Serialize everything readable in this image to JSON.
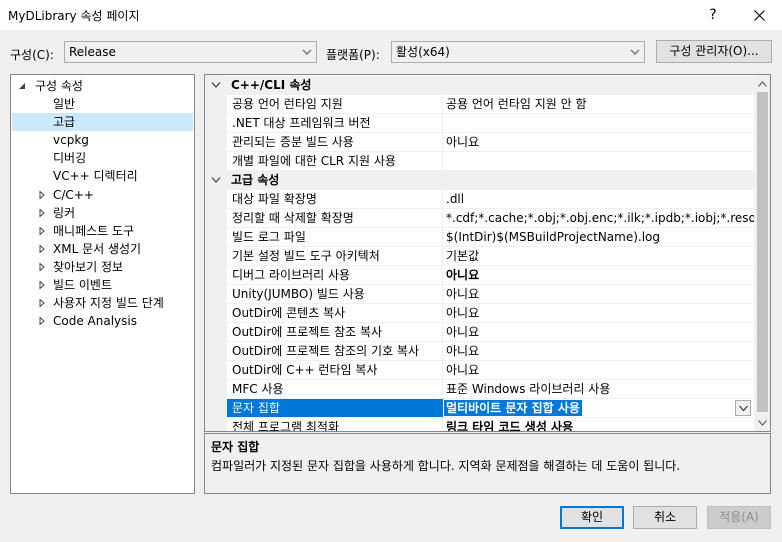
{
  "window": {
    "title": "MyDLibrary 속성 페이지",
    "help_label": "?",
    "close_icon": "close-icon"
  },
  "toolbar": {
    "config_label": "구성(C):",
    "config_value": "Release",
    "platform_label": "플랫폼(P):",
    "platform_value": "활성(x64)",
    "config_manager_label": "구성 관리자(O)..."
  },
  "tree": {
    "items": [
      {
        "label": "구성 속성",
        "expanded": true
      },
      {
        "label": "일반"
      },
      {
        "label": "고급",
        "selected": true
      },
      {
        "label": "vcpkg"
      },
      {
        "label": "디버깅"
      },
      {
        "label": "VC++ 디렉터리"
      },
      {
        "label": "C/C++",
        "collapsed": true
      },
      {
        "label": "링커",
        "collapsed": true
      },
      {
        "label": "매니페스트 도구",
        "collapsed": true
      },
      {
        "label": "XML 문서 생성기",
        "collapsed": true
      },
      {
        "label": "찾아보기 정보",
        "collapsed": true
      },
      {
        "label": "빌드 이벤트",
        "collapsed": true
      },
      {
        "label": "사용자 지정 빌드 단계",
        "collapsed": true
      },
      {
        "label": "Code Analysis",
        "collapsed": true
      }
    ]
  },
  "grid": {
    "categories": [
      {
        "label": "C++/CLI 속성"
      },
      {
        "label": "고급 속성"
      }
    ],
    "rows": [
      {
        "name": "공용 언어 런타임 지원",
        "value": "공용 언어 런타임 지원 안 함"
      },
      {
        "name": ".NET 대상 프레임워크 버전",
        "value": ""
      },
      {
        "name": "관리되는 증분 빌드 사용",
        "value": "아니요"
      },
      {
        "name": "개별 파일에 대한 CLR 지원 사용",
        "value": ""
      },
      {
        "name": "대상 파일 확장명",
        "value": ".dll"
      },
      {
        "name": "정리할 때 삭제할 확장명",
        "value": "*.cdf;*.cache;*.obj;*.obj.enc;*.ilk;*.ipdb;*.iobj;*.resources;*.tlb;*.tli;*.tlh"
      },
      {
        "name": "빌드 로그 파일",
        "value": "$(IntDir)$(MSBuildProjectName).log"
      },
      {
        "name": "기본 설정 빌드 도구 아키텍처",
        "value": "기본값"
      },
      {
        "name": "디버그 라이브러리 사용",
        "value": "아니요",
        "bold": true
      },
      {
        "name": "Unity(JUMBO) 빌드 사용",
        "value": "아니요"
      },
      {
        "name": "OutDir에 콘텐츠 복사",
        "value": "아니요"
      },
      {
        "name": "OutDir에 프로젝트 참조 복사",
        "value": "아니요"
      },
      {
        "name": "OutDir에 프로젝트 참조의 기호 복사",
        "value": "아니요"
      },
      {
        "name": "OutDir에 C++ 런타임 복사",
        "value": "아니요"
      },
      {
        "name": "MFC 사용",
        "value": "표준 Windows 라이브러리 사용"
      },
      {
        "name": "문자 집합",
        "value": "멀티바이트 문자 집합 사용",
        "selected": true
      },
      {
        "name": "전체 프로그램 최적화",
        "value": "링크 타임 코드 생성 사용",
        "bold": true
      }
    ]
  },
  "description": {
    "title": "문자 집합",
    "text": "컴파일러가 지정된 문자 집합을 사용하게 합니다. 지역화 문제점을 해결하는 데 도움이 됩니다."
  },
  "buttons": {
    "ok_label": "확인",
    "cancel_label": "취소",
    "apply_label": "적용(A)"
  },
  "colors": {
    "selection": "#0078d7",
    "tree_selection": "#cce8ff"
  }
}
